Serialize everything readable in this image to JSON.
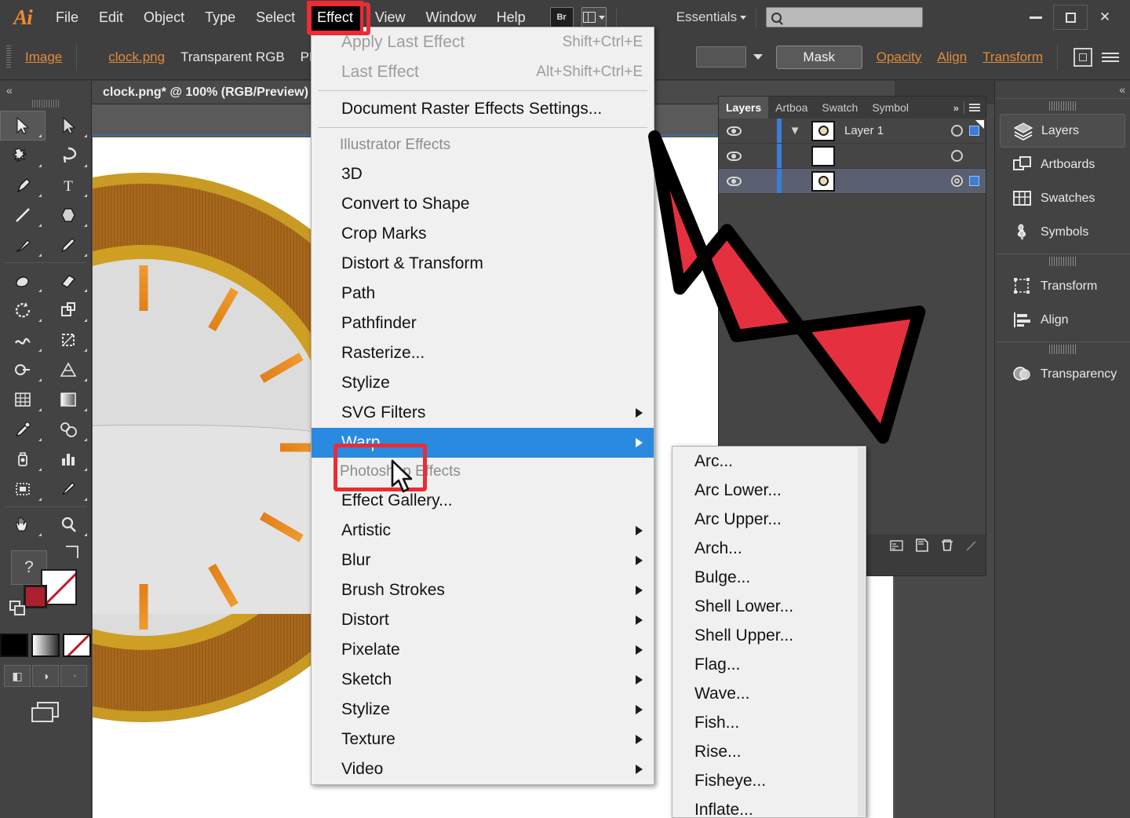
{
  "app": {
    "logo": "Ai",
    "menus": [
      "File",
      "Edit",
      "Object",
      "Type",
      "Select",
      "Effect",
      "View",
      "Window",
      "Help"
    ],
    "active_menu": "Effect",
    "bridge_button": "Br",
    "workspace": "Essentials",
    "search_placeholder": "",
    "accent_red": "#ed2b35",
    "accent_orange": "#e08c3a",
    "highlight_blue": "#2a8ae0"
  },
  "control_bar": {
    "object_type": "Image",
    "file_name": "clock.png",
    "color_space": "Transparent RGB",
    "ppi_label": "PPI",
    "mask_button": "Mask",
    "opacity_link": "Opacity",
    "align_link": "Align",
    "transform_link": "Transform"
  },
  "document": {
    "tab_title": "clock.png* @ 100% (RGB/Preview)"
  },
  "tools": {
    "items": [
      {
        "name": "selection-tool",
        "selected": true
      },
      {
        "name": "direct-selection-tool",
        "selected": false
      },
      {
        "name": "magic-wand-tool",
        "selected": false
      },
      {
        "name": "lasso-tool",
        "selected": false
      },
      {
        "name": "pen-tool",
        "selected": false
      },
      {
        "name": "type-tool",
        "selected": false
      },
      {
        "name": "line-segment-tool",
        "selected": false
      },
      {
        "name": "shape-tool",
        "selected": false
      },
      {
        "name": "paintbrush-tool",
        "selected": false
      },
      {
        "name": "pencil-tool",
        "selected": false
      },
      {
        "name": "blob-brush-tool",
        "selected": false
      },
      {
        "name": "eraser-tool",
        "selected": false
      },
      {
        "name": "rotate-tool",
        "selected": false
      },
      {
        "name": "scale-tool",
        "selected": false
      },
      {
        "name": "width-tool",
        "selected": false
      },
      {
        "name": "free-transform-tool",
        "selected": false
      },
      {
        "name": "shape-builder-tool",
        "selected": false
      },
      {
        "name": "perspective-grid-tool",
        "selected": false
      },
      {
        "name": "mesh-tool",
        "selected": false
      },
      {
        "name": "gradient-tool",
        "selected": false
      },
      {
        "name": "eyedropper-tool",
        "selected": false
      },
      {
        "name": "blend-tool",
        "selected": false
      },
      {
        "name": "symbol-sprayer-tool",
        "selected": false
      },
      {
        "name": "column-graph-tool",
        "selected": false
      },
      {
        "name": "artboard-tool",
        "selected": false
      },
      {
        "name": "slice-tool",
        "selected": false
      },
      {
        "name": "hand-tool",
        "selected": false
      },
      {
        "name": "zoom-tool",
        "selected": false
      }
    ],
    "help_glyph": "?",
    "draw_modes": [
      "draw-normal",
      "draw-behind",
      "draw-inside"
    ]
  },
  "effect_menu": {
    "groups": [
      {
        "items": [
          {
            "label": "Apply Last Effect",
            "accel": "Shift+Ctrl+E",
            "disabled": true,
            "submenu": false
          },
          {
            "label": "Last Effect",
            "accel": "Alt+Shift+Ctrl+E",
            "disabled": true,
            "submenu": false
          }
        ]
      },
      {
        "items": [
          {
            "label": "Document Raster Effects Settings...",
            "accel": "",
            "disabled": false,
            "submenu": false
          }
        ]
      },
      {
        "section": "Illustrator Effects",
        "items": [
          {
            "label": "3D",
            "accel": "",
            "disabled": false,
            "submenu": false
          },
          {
            "label": "Convert to Shape",
            "accel": "",
            "disabled": false,
            "submenu": false
          },
          {
            "label": "Crop Marks",
            "accel": "",
            "disabled": false,
            "submenu": false
          },
          {
            "label": "Distort & Transform",
            "accel": "",
            "disabled": false,
            "submenu": false
          },
          {
            "label": "Path",
            "accel": "",
            "disabled": false,
            "submenu": false
          },
          {
            "label": "Pathfinder",
            "accel": "",
            "disabled": false,
            "submenu": false
          },
          {
            "label": "Rasterize...",
            "accel": "",
            "disabled": false,
            "submenu": false
          },
          {
            "label": "Stylize",
            "accel": "",
            "disabled": false,
            "submenu": false
          },
          {
            "label": "SVG Filters",
            "accel": "",
            "disabled": false,
            "submenu": true
          },
          {
            "label": "Warp",
            "accel": "",
            "disabled": false,
            "submenu": true,
            "highlighted": true
          }
        ]
      },
      {
        "section": "Photoshop Effects",
        "items": [
          {
            "label": "Effect Gallery...",
            "accel": "",
            "disabled": false,
            "submenu": false
          },
          {
            "label": "Artistic",
            "accel": "",
            "disabled": false,
            "submenu": true
          },
          {
            "label": "Blur",
            "accel": "",
            "disabled": false,
            "submenu": true
          },
          {
            "label": "Brush Strokes",
            "accel": "",
            "disabled": false,
            "submenu": true
          },
          {
            "label": "Distort",
            "accel": "",
            "disabled": false,
            "submenu": true
          },
          {
            "label": "Pixelate",
            "accel": "",
            "disabled": false,
            "submenu": true
          },
          {
            "label": "Sketch",
            "accel": "",
            "disabled": false,
            "submenu": true
          },
          {
            "label": "Stylize",
            "accel": "",
            "disabled": false,
            "submenu": true
          },
          {
            "label": "Texture",
            "accel": "",
            "disabled": false,
            "submenu": true
          },
          {
            "label": "Video",
            "accel": "",
            "disabled": false,
            "submenu": true
          }
        ]
      }
    ]
  },
  "warp_submenu": {
    "items": [
      "Arc...",
      "Arc Lower...",
      "Arc Upper...",
      "Arch...",
      "Bulge...",
      "Shell Lower...",
      "Shell Upper...",
      "Flag...",
      "Wave...",
      "Fish...",
      "Rise...",
      "Fisheye...",
      "Inflate..."
    ]
  },
  "layers_panel": {
    "tabs": [
      "Layers",
      "Artboa",
      "Swatch",
      "Symbol"
    ],
    "active_tab": "Layers",
    "overflow_glyph": "»",
    "rows": [
      {
        "name": "Layer 1",
        "selected": false,
        "expanded": true,
        "visible": true,
        "has_target_fill": true
      },
      {
        "name": "",
        "selected": false,
        "expanded": false,
        "visible": true,
        "has_target_fill": false
      },
      {
        "name": "",
        "selected": true,
        "expanded": false,
        "visible": true,
        "has_target_fill": true
      }
    ]
  },
  "right_dock": {
    "groups": [
      {
        "items": [
          {
            "label": "Layers",
            "icon": "layers-icon",
            "active": true
          },
          {
            "label": "Artboards",
            "icon": "artboards-icon",
            "active": false
          },
          {
            "label": "Swatches",
            "icon": "swatches-icon",
            "active": false
          },
          {
            "label": "Symbols",
            "icon": "symbols-icon",
            "active": false
          }
        ]
      },
      {
        "items": [
          {
            "label": "Transform",
            "icon": "transform-icon",
            "active": false
          },
          {
            "label": "Align",
            "icon": "align-icon",
            "active": false
          }
        ]
      },
      {
        "items": [
          {
            "label": "Transparency",
            "icon": "transparency-icon",
            "active": false
          }
        ]
      }
    ]
  },
  "artwork": {
    "description": "wooden-clock-face",
    "rim_color": "#a9691d",
    "bezel_color": "#cf9f24",
    "face_color": "#dcdcdc",
    "tick_color": "#ef9226"
  },
  "annotations": {
    "effect_menu_highlight_color": "#ed2b35",
    "warp_highlight_color": "#ed2b35",
    "arrow_fill": "#e5303f",
    "arrow_stroke": "#000000"
  }
}
